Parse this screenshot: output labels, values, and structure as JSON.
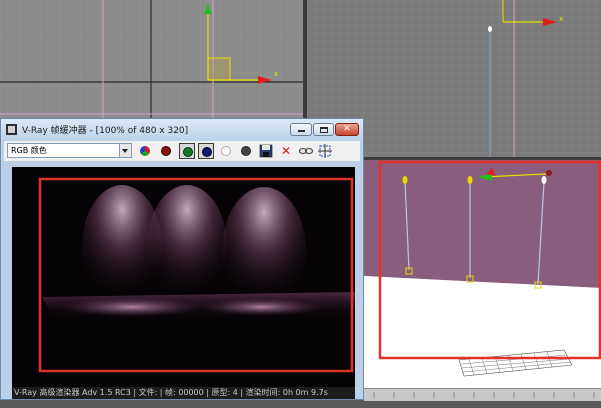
{
  "vfb": {
    "title": "V-Ray 帧缓冲器 - [100% of 480 x 320]",
    "channel_selected": "RGB 颜色",
    "status": "V-Ray 高级渲染器 Adv 1.5 RC3 | 文件: | 帧: 00000 | 原型: 4 | 渲染时间: 0h 0m 9.7s",
    "close_glyph": "✕",
    "x_glyph": "✕"
  },
  "viewports": {
    "top_left_axis_label": "x",
    "top_right_axis_label": "x"
  },
  "colors": {
    "selection_red": "#e2322a",
    "axis_green": "#20c020",
    "axis_red": "#e02020",
    "axis_yellow": "#e8e000",
    "wall_pink": "#8a5d7c"
  }
}
